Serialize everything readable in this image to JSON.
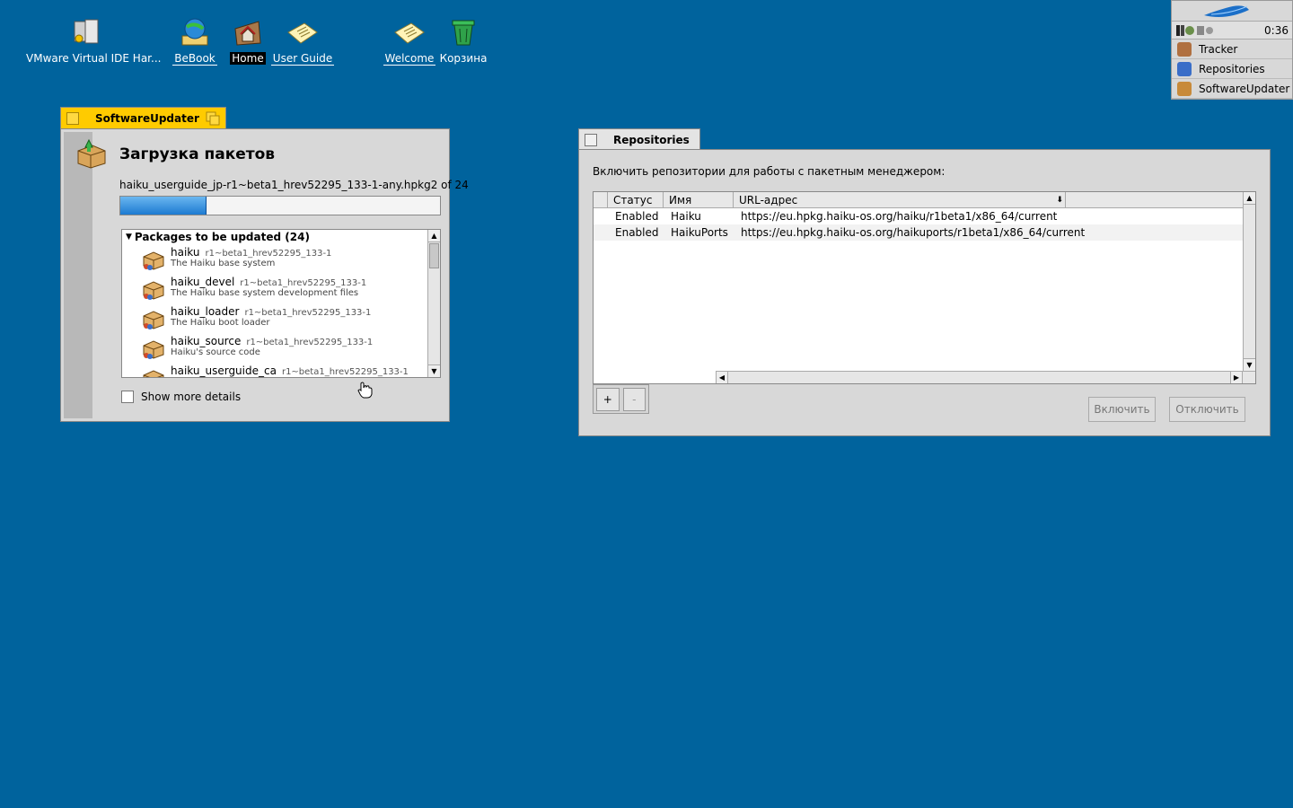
{
  "desktop": {
    "icons": [
      {
        "label": "VMware Virtual IDE Har...",
        "icon": "hard-disk-icon"
      },
      {
        "label": "BeBook",
        "icon": "globe-book-icon"
      },
      {
        "label": "Home",
        "icon": "home-folder-icon"
      },
      {
        "label": "User Guide",
        "icon": "document-icon"
      },
      {
        "label": "Welcome",
        "icon": "document-icon"
      },
      {
        "label": "Корзина",
        "icon": "trash-icon"
      }
    ]
  },
  "deskbar": {
    "clock": "0:36",
    "items": [
      {
        "label": "Tracker",
        "icon": "tracker-icon"
      },
      {
        "label": "Repositories",
        "icon": "repositories-icon"
      },
      {
        "label": "SoftwareUpdater",
        "icon": "software-updater-icon"
      }
    ]
  },
  "software_updater": {
    "title": "SoftwareUpdater",
    "heading": "Загрузка пакетов",
    "current_file": "haiku_userguide_jp-r1~beta1_hrev52295_133-1-any.hpkg",
    "counter": "2 of 24",
    "progress": 0.27,
    "group_label": "Packages to be updated (24)",
    "packages": [
      {
        "name": "haiku",
        "version": "r1~beta1_hrev52295_133-1",
        "description": "The Haiku base system"
      },
      {
        "name": "haiku_devel",
        "version": "r1~beta1_hrev52295_133-1",
        "description": "The Haiku base system development files"
      },
      {
        "name": "haiku_loader",
        "version": "r1~beta1_hrev52295_133-1",
        "description": "The Haiku boot loader"
      },
      {
        "name": "haiku_source",
        "version": "r1~beta1_hrev52295_133-1",
        "description": "Haiku's source code"
      },
      {
        "name": "haiku_userguide_ca",
        "version": "r1~beta1_hrev52295_133-1",
        "description": ""
      }
    ],
    "show_details_label": "Show more details"
  },
  "repositories": {
    "title": "Repositories",
    "prompt": "Включить репозитории для работы с пакетным менеджером:",
    "columns": {
      "status": "Статус",
      "name": "Имя",
      "url": "URL-адрес"
    },
    "rows": [
      {
        "status": "Enabled",
        "name": "Haiku",
        "url": "https://eu.hpkg.haiku-os.org/haiku/r1beta1/x86_64/current"
      },
      {
        "status": "Enabled",
        "name": "HaikuPorts",
        "url": "https://eu.hpkg.haiku-os.org/haikuports/r1beta1/x86_64/current"
      }
    ],
    "add_label": "+",
    "remove_label": "-",
    "enable_label": "Включить",
    "disable_label": "Отключить"
  },
  "colors": {
    "desktop": "#00639d",
    "active_tab": "#ffcb00",
    "progress": "#1c7ad1"
  }
}
